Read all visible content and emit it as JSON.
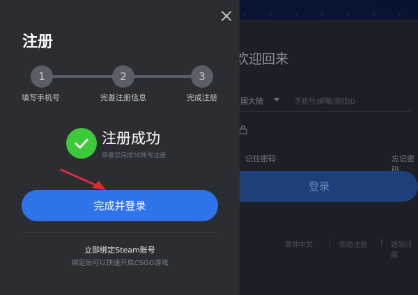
{
  "registration": {
    "title": "注册",
    "close_icon": "close-icon",
    "steps": [
      {
        "number": "1",
        "label": "填写手机号"
      },
      {
        "number": "2",
        "label": "完善注册信息"
      },
      {
        "number": "3",
        "label": "完成注册"
      }
    ],
    "success": {
      "icon": "check-circle-icon",
      "title": "注册成功",
      "subtitle": "恭喜您完成5E账号注册"
    },
    "primary_button": "完成并登录",
    "bind_link": "立即绑定Steam账号",
    "bind_hint": "绑定后可以快速开启CSGO游戏"
  },
  "background_login": {
    "title": "欢迎回来",
    "region": "国大陆",
    "phone_placeholder": "手机号/邮箱/游戏ID",
    "remember_label": "记住密码",
    "forgot_label": "忘记密码",
    "login_button": "登录",
    "footer": [
      "繁体中文",
      "帮助注册",
      "遇到问题"
    ]
  },
  "colors": {
    "accent": "#2f74ea",
    "success": "#3ec93a",
    "panel": "#2b2d33",
    "annotation_arrow": "#e0283a"
  }
}
